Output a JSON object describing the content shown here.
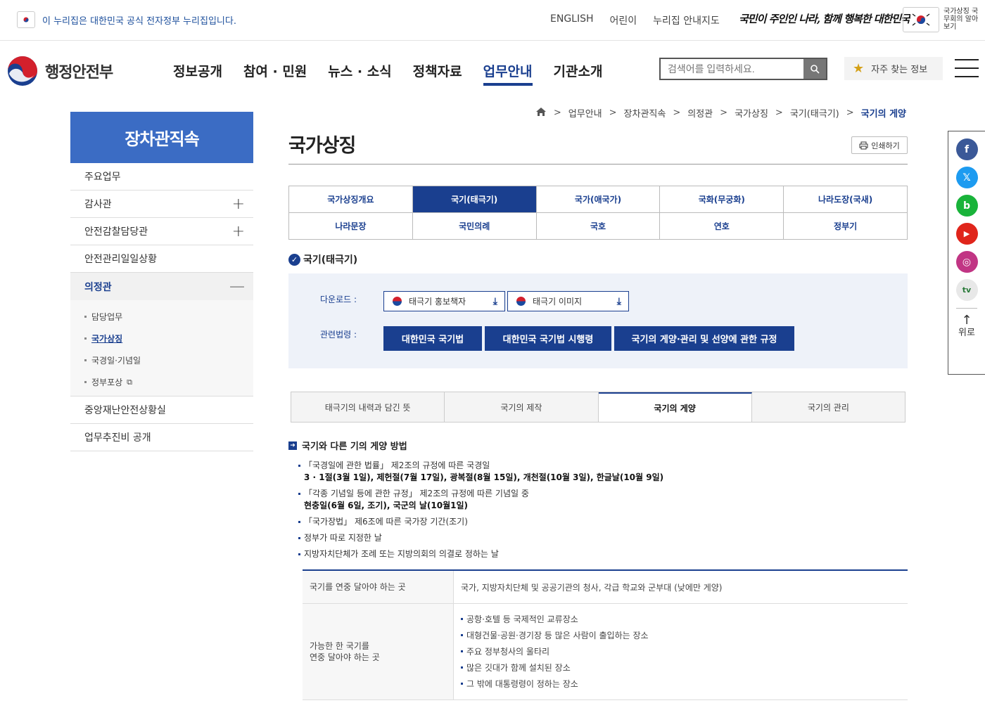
{
  "topbar": {
    "nuri_text": "이 누리집은 대한민국 공식 전자정부 누리집입니다.",
    "links": [
      "ENGLISH",
      "어린이",
      "누리집 안내지도"
    ],
    "slogan": "국민이 주인인 나라, 함께 행복한 대한민국",
    "national_symbol_text": "국가상징 국무회의 알아보기"
  },
  "header": {
    "ministry_name": "행정안전부",
    "gnb": [
      "정보공개",
      "참여 · 민원",
      "뉴스 · 소식",
      "정책자료",
      "업무안내",
      "기관소개"
    ],
    "gnb_active": "업무안내",
    "search_placeholder": "검색어를 입력하세요.",
    "favorite_label": "자주 찾는 정보"
  },
  "lnb": {
    "title": "장차관직속",
    "items": [
      {
        "label": "주요업무",
        "toggle": ""
      },
      {
        "label": "감사관",
        "toggle": "+"
      },
      {
        "label": "안전감찰담당관",
        "toggle": "+"
      },
      {
        "label": "안전관리일일상황",
        "toggle": ""
      },
      {
        "label": "의정관",
        "toggle": "—"
      }
    ],
    "sub_items": [
      "담당업무",
      "국가상징",
      "국경일·기념일",
      "정부포상"
    ],
    "items_after": [
      "중앙재난안전상황실",
      "업무추진비 공개"
    ]
  },
  "breadcrumb": [
    "업무안내",
    "장차관직속",
    "의정관",
    "국가상징",
    "국기(태극기)",
    "국기의 게양"
  ],
  "page_title": "국가상징",
  "print_label": "인쇄하기",
  "tabs": [
    "국가상징개요",
    "국기(태극기)",
    "국가(애국가)",
    "국화(무궁화)",
    "나라도장(국새)",
    "나라문장",
    "국민의례",
    "국호",
    "연호",
    "정부기"
  ],
  "active_tab": "국기(태극기)",
  "section_title": "국기(태극기)",
  "download": {
    "label": "다운로드 :",
    "buttons": [
      "태극기 홍보책자",
      "태극기 이미지"
    ],
    "law_label": "관련법령 :",
    "laws": [
      "대한민국 국기법",
      "대한민국 국기법 시행령",
      "국기의 게양·관리 및 선양에 관한 규정"
    ]
  },
  "subtabs": [
    "태극기의 내력과 담긴 뜻",
    "국기의 제작",
    "국기의 게양",
    "국기의 관리"
  ],
  "active_subtab": "국기의 게양",
  "content": {
    "heading": "국기와 다른 기의 게양 방법",
    "bullets": [
      {
        "text": "「국경일에 관한 법률」 제2조의 규정에 따른 국경일",
        "strong": "3 · 1절(3월 1일), 제헌절(7월 17일), 광복절(8월 15일), 개천절(10월 3일), 한글날(10월 9일)"
      },
      {
        "text": "「각종 기념일 등에 관한 규정」 제2조의 규정에 따른 기념일 중",
        "strong": "현충일(6월 6일, 조기), 국군의 날(10월1일)"
      },
      {
        "text": "「국가장법」 제6조에 따른 국가장 기간(조기)",
        "strong": ""
      },
      {
        "text": "정부가 따로 지정한 날",
        "strong": ""
      },
      {
        "text": "지방자치단체가 조례 또는 지방의회의 의결로 정하는 날",
        "strong": ""
      }
    ],
    "table": {
      "row1_th": "국기를 연중 달아야 하는 곳",
      "row1_td": "국가, 지방자치단체 및 공공기관의 청사, 각급 학교와 군부대 (낮에만 게양)",
      "row2_th": "가능한 한 국기를\n연중 달아야 하는 곳",
      "row2_items": [
        "공항·호텔 등 국제적인 교류장소",
        "대형건물·공원·경기장 등 많은 사람이 출입하는 장소",
        "주요 정부청사의 울타리",
        "많은 깃대가 함께 설치된 장소",
        "그 밖에 대통령령이 정하는 장소"
      ]
    }
  },
  "sns": {
    "icons": [
      {
        "name": "facebook-icon",
        "glyph": "f",
        "color": "#3b5998"
      },
      {
        "name": "x-icon",
        "glyph": "𝕏",
        "color": "#1d9bf0"
      },
      {
        "name": "blog-icon",
        "glyph": "b",
        "color": "#19b33a"
      },
      {
        "name": "youtube-icon",
        "glyph": "▶",
        "color": "#e0251b"
      },
      {
        "name": "instagram-icon",
        "glyph": "◎",
        "color": "#c13584"
      },
      {
        "name": "tv-icon",
        "glyph": "tv",
        "color": "#e8e8e8"
      }
    ],
    "top_label": "위로",
    "top_glyph": "↑"
  }
}
